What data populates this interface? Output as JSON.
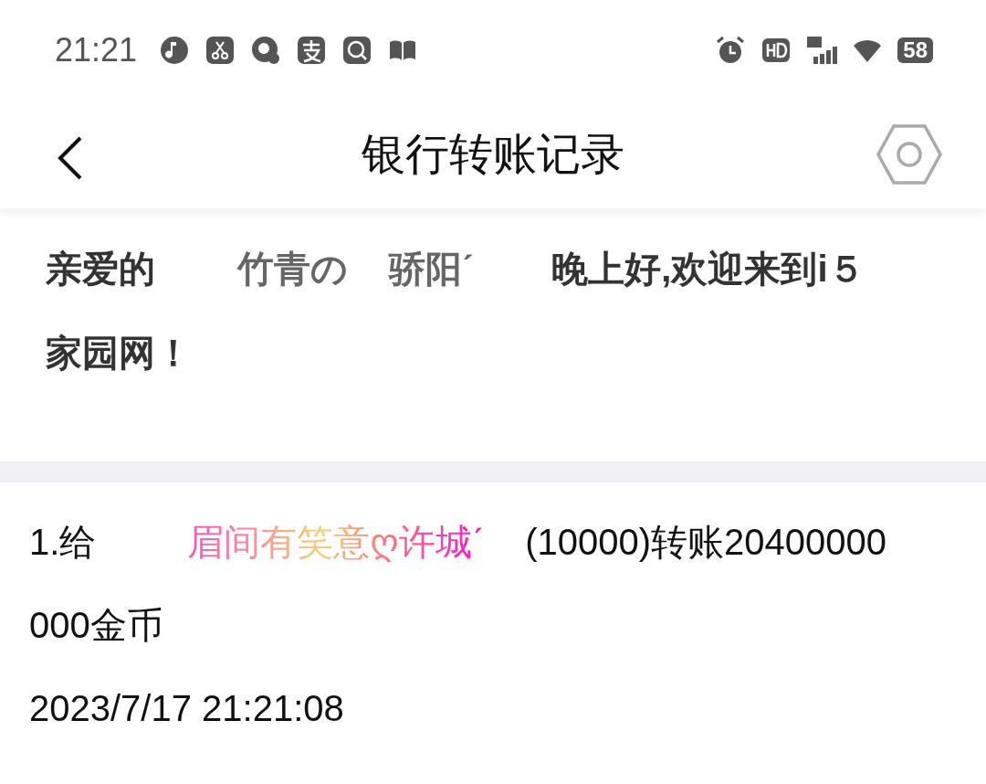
{
  "status_bar": {
    "time": "21:21",
    "battery": "58"
  },
  "header": {
    "title": "银行转账记录"
  },
  "greeting": {
    "prefix": "亲爱的",
    "name_parts": [
      "竹青の",
      "骄阳ˊ"
    ],
    "suffix": "晚上好,欢迎来到i５家园网！"
  },
  "records": [
    {
      "prefix": "1.给",
      "recipient": "眉间有笑意ღ许城ˊ",
      "detail": "(10000)转账20400000000金币",
      "time": "2023/7/17 21:21:08"
    }
  ]
}
